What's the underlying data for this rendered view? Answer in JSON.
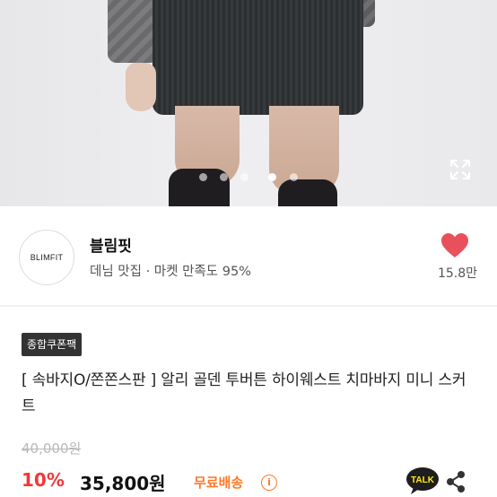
{
  "gallery": {
    "image": "product-photo-corduroy-mini-skirt",
    "dot_count": 5,
    "active_dot_index": 4,
    "expand_icon": "expand-icon"
  },
  "seller": {
    "logo_text": "BLIMFIT",
    "name": "블림핏",
    "subtitle": "데님 맛집 · 마켓 만족도 95%",
    "like_icon": "heart-icon",
    "like_color": "#e8505b",
    "like_count": "15.8만"
  },
  "product": {
    "badge": "종합쿠폰팩",
    "title": "[ 속바지O/쫀쫀스판 ] 알리 골덴 투버튼 하이웨스트 치마바지 미니 스커트",
    "original_price": "40,000원",
    "discount": "10%",
    "price": "35,800원",
    "shipping": "무료배송",
    "shipping_info_icon": "info-icon",
    "chat_icon": "kakaotalk-icon",
    "chat_label": "TALK",
    "share_icon": "share-icon"
  },
  "colors": {
    "discount": "#f23838",
    "shipping": "#ff7a2b"
  }
}
